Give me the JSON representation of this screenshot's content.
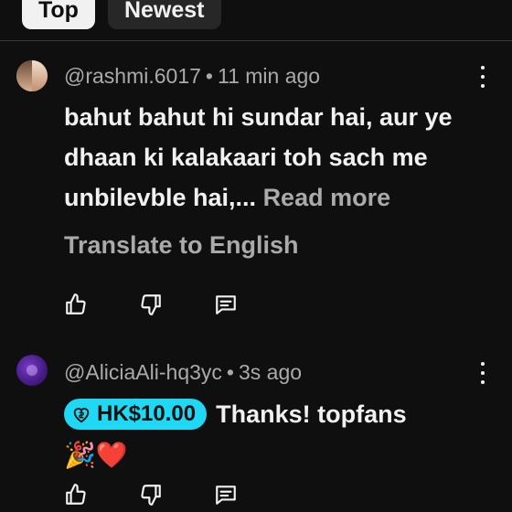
{
  "chips": {
    "top": "Top",
    "newest": "Newest"
  },
  "comments": [
    {
      "handle": "@rashmi.6017",
      "separator": "•",
      "time": "11 min ago",
      "text": "bahut bahut hi sundar hai, aur ye dhaan ki kalakaari toh sach me unbilevble hai,...",
      "read_more": "Read more",
      "translate": "Translate to English"
    },
    {
      "handle": "@AliciaAli-hq3yc",
      "separator": "•",
      "time": "3s ago",
      "superchat_amount": "HK$10.00",
      "text": "Thanks! topfans",
      "emojis": "🎉❤️"
    }
  ],
  "icons": {
    "like": "thumbs-up-icon",
    "dislike": "thumbs-down-icon",
    "reply": "reply-comment-icon",
    "menu": "more-vert-icon",
    "superchat": "super-thanks-heart-icon"
  },
  "colors": {
    "background": "#0f0f0f",
    "superchat": "#1ed8f4",
    "secondary_text": "#aaaaaa"
  }
}
